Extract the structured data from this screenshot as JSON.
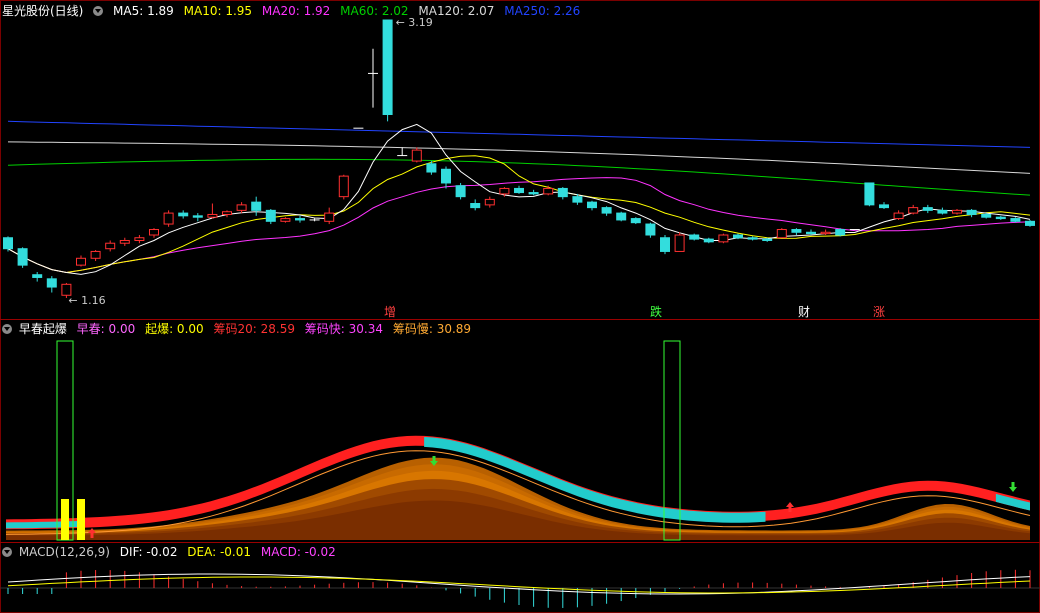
{
  "main": {
    "name": "星光股份(日线)",
    "ma": [
      {
        "label": "MA5: 1.89",
        "color": "#ffffff"
      },
      {
        "label": "MA10: 1.95",
        "color": "#ffff00"
      },
      {
        "label": "MA20: 1.92",
        "color": "#ff33ff"
      },
      {
        "label": "MA60: 2.02",
        "color": "#00d000"
      },
      {
        "label": "MA120: 2.07",
        "color": "#d8d8d8"
      },
      {
        "label": "MA250: 2.26",
        "color": "#2244ff"
      }
    ],
    "high_label": "3.19",
    "low_label": "1.16"
  },
  "events": [
    {
      "text": "增",
      "color": "#ff4040"
    },
    {
      "text": "跌",
      "color": "#40ff40"
    },
    {
      "text": "财",
      "color": "#ffffff"
    },
    {
      "text": "涨",
      "color": "#ff4040"
    }
  ],
  "ind1": {
    "name": "早春起爆",
    "items": [
      {
        "label": "早春: 0.00",
        "color": "#ff66ff"
      },
      {
        "label": "起爆: 0.00",
        "color": "#ffff00"
      },
      {
        "label": "筹码20: 28.59",
        "color": "#ff3333"
      },
      {
        "label": "筹码快: 30.34",
        "color": "#ff44ff"
      },
      {
        "label": "筹码慢: 30.89",
        "color": "#ffaa33"
      }
    ]
  },
  "ind2": {
    "name": "MACD(12,26,9)",
    "items": [
      {
        "label": "DIF: -0.02",
        "color": "#ffffff"
      },
      {
        "label": "DEA: -0.01",
        "color": "#ffff00"
      },
      {
        "label": "MACD: -0.02",
        "color": "#ff44ff"
      }
    ]
  },
  "chart_data": {
    "type": "candlestick",
    "candles": [
      [
        1.6,
        1.52,
        1.61,
        1.5
      ],
      [
        1.52,
        1.4,
        1.53,
        1.38
      ],
      [
        1.33,
        1.31,
        1.35,
        1.28
      ],
      [
        1.3,
        1.24,
        1.32,
        1.2
      ],
      [
        1.18,
        1.26,
        1.27,
        1.16
      ],
      [
        1.4,
        1.45,
        1.47,
        1.39
      ],
      [
        1.45,
        1.5,
        1.51,
        1.43
      ],
      [
        1.52,
        1.56,
        1.58,
        1.5
      ],
      [
        1.56,
        1.58,
        1.6,
        1.54
      ],
      [
        1.58,
        1.6,
        1.62,
        1.56
      ],
      [
        1.62,
        1.66,
        1.67,
        1.6
      ],
      [
        1.7,
        1.78,
        1.8,
        1.68
      ],
      [
        1.78,
        1.76,
        1.8,
        1.74
      ],
      [
        1.76,
        1.75,
        1.78,
        1.72
      ],
      [
        1.75,
        1.77,
        1.85,
        1.74
      ],
      [
        1.77,
        1.79,
        1.8,
        1.75
      ],
      [
        1.8,
        1.84,
        1.86,
        1.78
      ],
      [
        1.86,
        1.8,
        1.9,
        1.76
      ],
      [
        1.8,
        1.72,
        1.81,
        1.7
      ],
      [
        1.72,
        1.74,
        1.75,
        1.71
      ],
      [
        1.74,
        1.73,
        1.76,
        1.71
      ],
      [
        1.73,
        1.73,
        1.74,
        1.72
      ],
      [
        1.72,
        1.78,
        1.82,
        1.7
      ],
      [
        1.9,
        2.05,
        2.06,
        1.88
      ],
      [
        2.4,
        2.4,
        2.4,
        2.4
      ],
      [
        2.8,
        2.8,
        2.98,
        2.55
      ],
      [
        3.19,
        2.5,
        3.19,
        2.45
      ],
      [
        2.2,
        2.2,
        2.26,
        2.2
      ],
      [
        2.16,
        2.24,
        2.26,
        2.15
      ],
      [
        2.14,
        2.08,
        2.16,
        2.06
      ],
      [
        2.1,
        2.0,
        2.12,
        1.96
      ],
      [
        1.98,
        1.9,
        2.0,
        1.88
      ],
      [
        1.85,
        1.82,
        1.88,
        1.8
      ],
      [
        1.84,
        1.88,
        1.9,
        1.82
      ],
      [
        1.92,
        1.96,
        1.97,
        1.9
      ],
      [
        1.96,
        1.93,
        1.98,
        1.92
      ],
      [
        1.93,
        1.92,
        1.95,
        1.91
      ],
      [
        1.92,
        1.96,
        1.98,
        1.91
      ],
      [
        1.96,
        1.9,
        1.97,
        1.88
      ],
      [
        1.9,
        1.86,
        1.92,
        1.84
      ],
      [
        1.86,
        1.82,
        1.87,
        1.8
      ],
      [
        1.82,
        1.78,
        1.83,
        1.76
      ],
      [
        1.78,
        1.73,
        1.79,
        1.72
      ],
      [
        1.74,
        1.71,
        1.75,
        1.7
      ],
      [
        1.7,
        1.62,
        1.71,
        1.6
      ],
      [
        1.6,
        1.5,
        1.62,
        1.48
      ],
      [
        1.5,
        1.62,
        1.64,
        1.5
      ],
      [
        1.62,
        1.59,
        1.63,
        1.58
      ],
      [
        1.59,
        1.57,
        1.6,
        1.56
      ],
      [
        1.57,
        1.62,
        1.63,
        1.56
      ],
      [
        1.62,
        1.6,
        1.63,
        1.59
      ],
      [
        1.6,
        1.59,
        1.61,
        1.58
      ],
      [
        1.59,
        1.58,
        1.6,
        1.57
      ],
      [
        1.6,
        1.66,
        1.67,
        1.6
      ],
      [
        1.66,
        1.64,
        1.67,
        1.62
      ],
      [
        1.64,
        1.63,
        1.66,
        1.62
      ],
      [
        1.63,
        1.64,
        1.66,
        1.62
      ],
      [
        1.66,
        1.62,
        1.67,
        1.61
      ],
      [
        1.66,
        1.66,
        1.66,
        1.66
      ],
      [
        2.0,
        1.84,
        2.0,
        1.83
      ],
      [
        1.84,
        1.82,
        1.86,
        1.81
      ],
      [
        1.74,
        1.78,
        1.8,
        1.73
      ],
      [
        1.78,
        1.82,
        1.84,
        1.77
      ],
      [
        1.82,
        1.8,
        1.84,
        1.78
      ],
      [
        1.8,
        1.78,
        1.82,
        1.77
      ],
      [
        1.78,
        1.8,
        1.81,
        1.77
      ],
      [
        1.8,
        1.77,
        1.81,
        1.75
      ],
      [
        1.77,
        1.75,
        1.78,
        1.74
      ],
      [
        1.75,
        1.74,
        1.76,
        1.73
      ],
      [
        1.74,
        1.72,
        1.75,
        1.71
      ],
      [
        1.72,
        1.69,
        1.73,
        1.68
      ]
    ],
    "ma_last": {
      "MA5": 1.89,
      "MA10": 1.95,
      "MA20": 1.92,
      "MA60": 2.02,
      "MA120": 2.07,
      "MA250": 2.26
    },
    "price_range": [
      1.16,
      3.19
    ]
  }
}
